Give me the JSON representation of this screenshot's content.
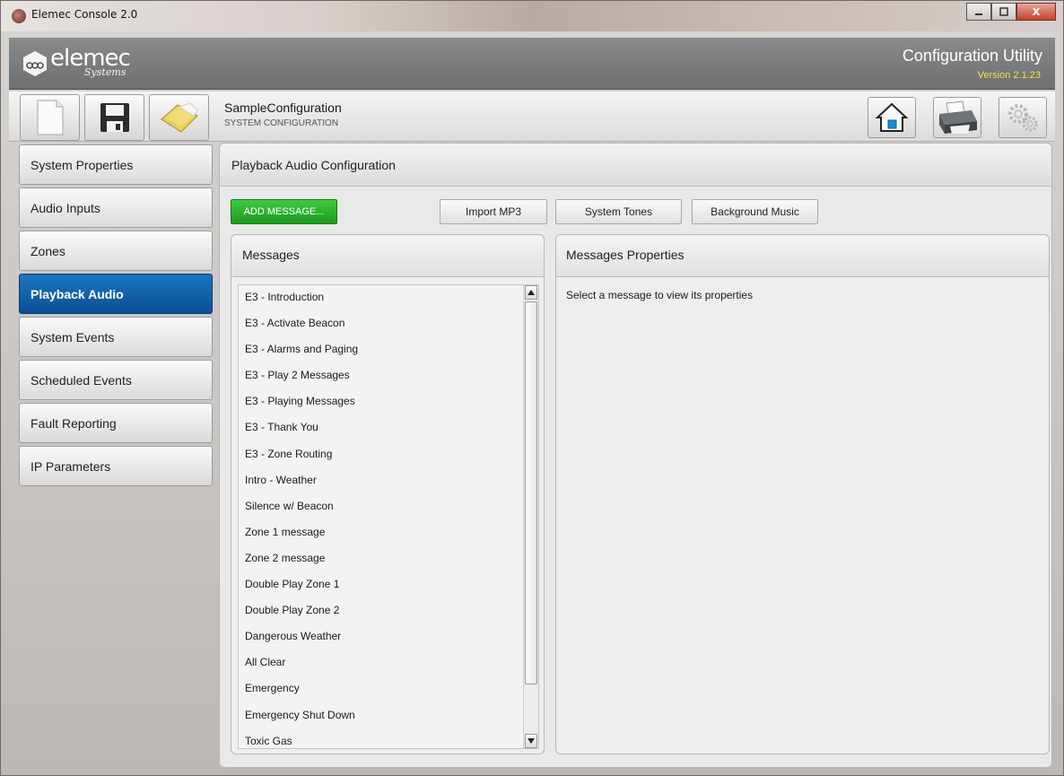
{
  "window": {
    "title": "Elemec Console 2.0",
    "minimize_icon": "minimize-icon",
    "maximize_icon": "maximize-icon",
    "close_label": "X"
  },
  "header": {
    "logo_text": "elemec",
    "logo_sub": "Systems",
    "app_title": "Configuration Utility",
    "version": "Version 2.1.23"
  },
  "toolbar": {
    "config_name": "SampleConfiguration",
    "config_sub": "SYSTEM CONFIGURATION",
    "tools_left": [
      "new-document-icon",
      "save-disk-icon",
      "open-folder-icon"
    ],
    "tools_right": [
      "home-icon",
      "printer-icon",
      "settings-gears-icon"
    ]
  },
  "sidebar": {
    "items": [
      {
        "label": "System Properties",
        "active": false
      },
      {
        "label": "Audio Inputs",
        "active": false
      },
      {
        "label": "Zones",
        "active": false
      },
      {
        "label": "Playback Audio",
        "active": true
      },
      {
        "label": "System Events",
        "active": false
      },
      {
        "label": "Scheduled Events",
        "active": false
      },
      {
        "label": "Fault Reporting",
        "active": false
      },
      {
        "label": "IP Parameters",
        "active": false
      }
    ]
  },
  "main": {
    "title": "Playback Audio Configuration",
    "add_button": "ADD MESSAGE...",
    "import_button": "Import MP3",
    "tones_button": "System Tones",
    "music_button": "Background Music",
    "messages_header": "Messages",
    "messages": [
      "E3  - Introduction",
      "E3 - Activate Beacon",
      "E3 - Alarms and Paging",
      "E3 - Play 2 Messages",
      "E3 - Playing Messages",
      "E3 - Thank You",
      "E3 - Zone Routing",
      "Intro - Weather",
      "Silence w/ Beacon",
      "Zone 1 message",
      "Zone 2 message",
      "Double Play Zone 1",
      "Double Play Zone 2",
      "Dangerous Weather",
      "All Clear",
      "Emergency",
      "Emergency Shut Down",
      "Toxic Gas"
    ],
    "properties_header": "Messages Properties",
    "properties_hint": "Select a message to view its properties"
  },
  "colors": {
    "active_nav": "#0b5ea8",
    "add_button": "#2cb52e",
    "version_text": "#f1e34a"
  }
}
